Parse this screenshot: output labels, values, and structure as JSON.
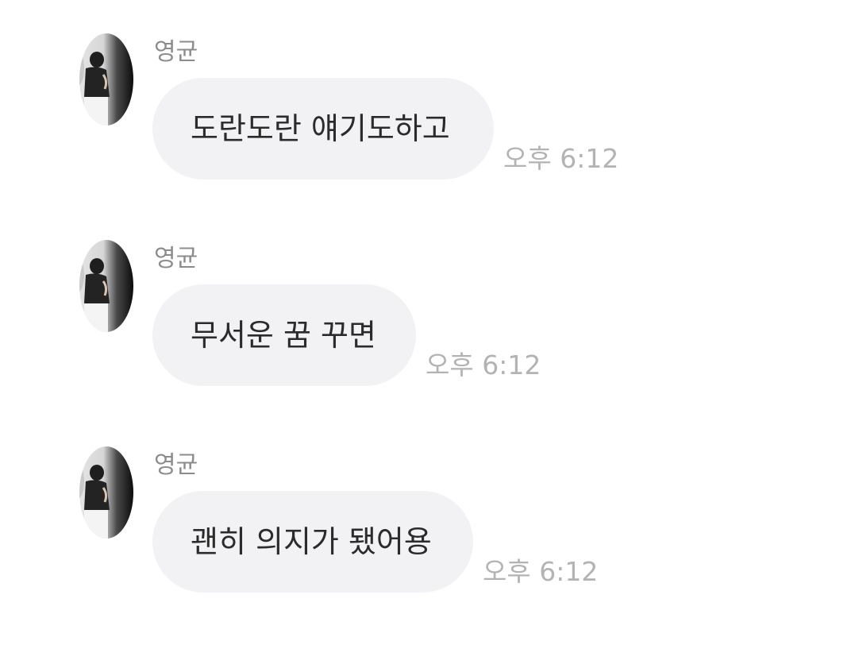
{
  "messages": [
    {
      "sender": "영균",
      "text": "도란도란 얘기도하고",
      "time": "오후 6:12"
    },
    {
      "sender": "영균",
      "text": "무서운 꿈 꾸면",
      "time": "오후 6:12"
    },
    {
      "sender": "영균",
      "text": "괜히 의지가 됐어용",
      "time": "오후 6:12"
    }
  ],
  "colors": {
    "bubble": "#f2f2f4",
    "text": "#2b2b2b",
    "sender": "#8c8c8c",
    "time": "#b3b3b3"
  }
}
